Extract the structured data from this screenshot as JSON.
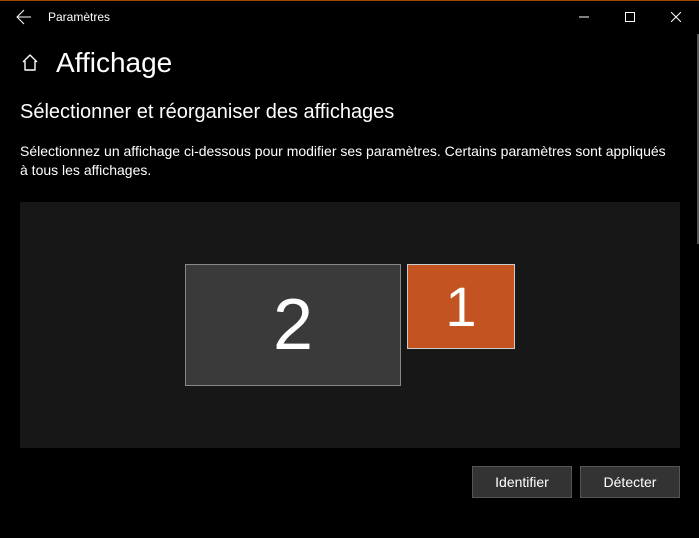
{
  "window": {
    "title": "Paramètres"
  },
  "page": {
    "title": "Affichage"
  },
  "section": {
    "title": "Sélectionner et réorganiser des affichages",
    "description": "Sélectionnez un affichage ci-dessous pour modifier ses paramètres. Certains paramètres sont appliqués à tous les affichages."
  },
  "displays": {
    "monitor1_label": "1",
    "monitor2_label": "2",
    "selected": 1,
    "accent_color": "#c35321"
  },
  "buttons": {
    "identify": "Identifier",
    "detect": "Détecter"
  }
}
